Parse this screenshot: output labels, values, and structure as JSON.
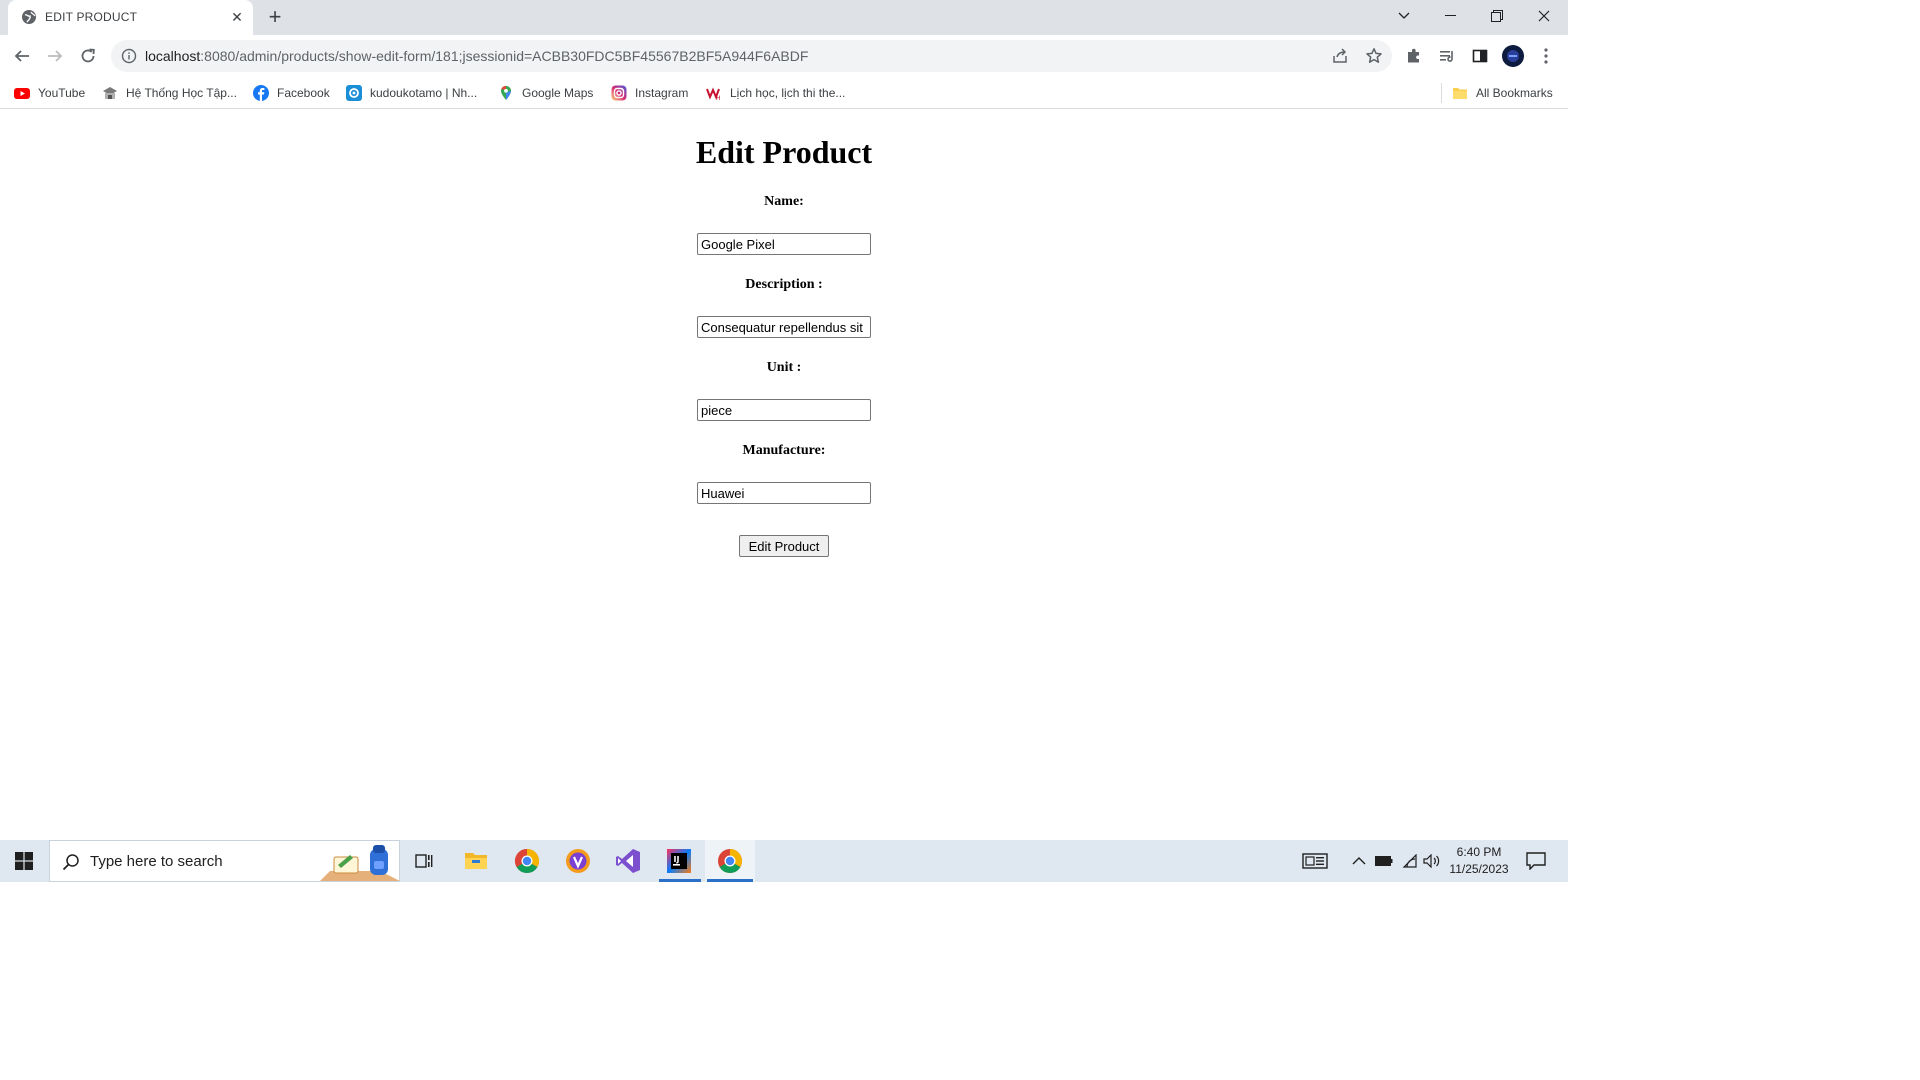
{
  "browser": {
    "tab_title": "EDIT PRODUCT",
    "url_host": "localhost",
    "url_rest": ":8080/admin/products/show-edit-form/181;jsessionid=ACBB30FDC5BF45567B2BF5A944F6ABDF",
    "bookmarks": [
      {
        "label": "YouTube",
        "icon": "youtube-icon"
      },
      {
        "label": "Hệ Thống Học Tập...",
        "icon": "school-icon"
      },
      {
        "label": "Facebook",
        "icon": "facebook-icon"
      },
      {
        "label": "kudoukotamo | Nh...",
        "icon": "site-icon"
      },
      {
        "label": "Google Maps",
        "icon": "maps-pin-icon"
      },
      {
        "label": "Instagram",
        "icon": "instagram-icon"
      },
      {
        "label": "Lịch học, lịch thi the...",
        "icon": "site-icon"
      }
    ],
    "all_bookmarks_label": "All Bookmarks"
  },
  "form": {
    "title": "Edit Product",
    "name_label": "Name:",
    "name_value": "Google Pixel",
    "description_label": "Description :",
    "description_value": "Consequatur repellendus sit",
    "unit_label": "Unit :",
    "unit_value": "piece",
    "manufacture_label": "Manufacture:",
    "manufacture_value": "Huawei",
    "submit_label": "Edit Product"
  },
  "taskbar": {
    "search_placeholder": "Type here to search",
    "time": "6:40 PM",
    "date": "11/25/2023"
  },
  "colors": {
    "tabstrip": "#dee1e6",
    "omnibox": "#f1f3f4",
    "taskbar": "#dfe8f1",
    "accent": "#2b6fc6"
  }
}
